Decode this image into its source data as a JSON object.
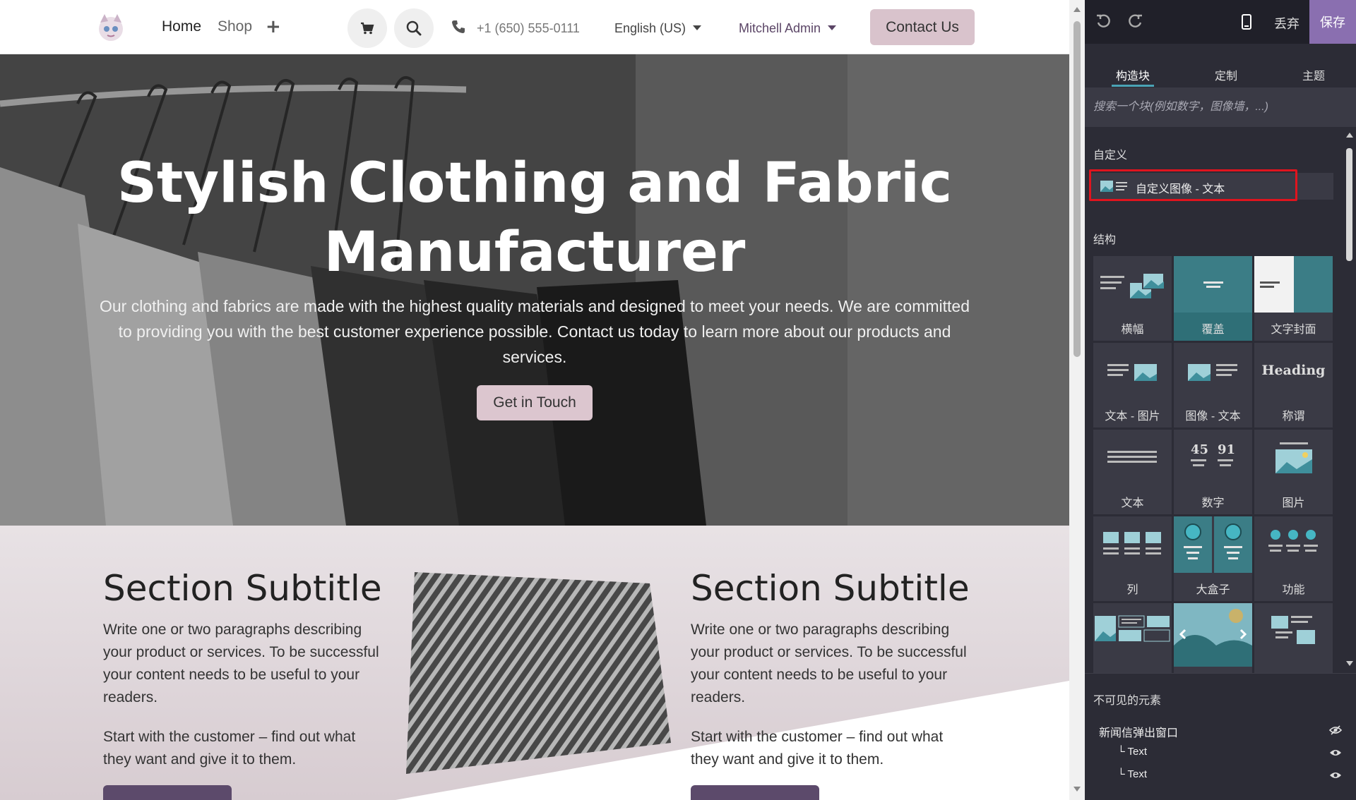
{
  "navbar": {
    "home": "Home",
    "shop": "Shop",
    "phone": "+1 (650) 555-0111",
    "language": "English (US)",
    "user": "Mitchell Admin",
    "contact": "Contact Us"
  },
  "hero": {
    "title": "Stylish Clothing and Fabric Manufacturer",
    "text": "Our clothing and fabrics are made with the highest quality materials and designed to meet your needs. We are committed to providing you with the best customer experience possible. Contact us today to learn more about our products and services.",
    "button": "Get in Touch"
  },
  "sections": [
    {
      "title": "Section Subtitle",
      "para1": "Write one or two paragraphs describing your product or services. To be successful your content needs to be useful to your readers.",
      "para2": "Start with the customer – find out what they want and give it to them."
    },
    {
      "title": "Section Subtitle",
      "para1": "Write one or two paragraphs describing your product or services. To be successful your content needs to be useful to your readers.",
      "para2": "Start with the customer – find out what they want and give it to them."
    }
  ],
  "editor": {
    "discard": "丢弃",
    "save": "保存",
    "tabs": [
      "构造块",
      "定制",
      "主题"
    ],
    "search_placeholder": "搜索一个块(例如数字，图像墙，...)",
    "custom_title": "自定义",
    "custom_item": "自定义图像 - 文本",
    "structure_title": "结构",
    "tiles": [
      "横幅",
      "覆盖",
      "文字封面",
      "文本 - 图片",
      "图像 - 文本",
      "称谓",
      "文本",
      "数字",
      "图片",
      "列",
      "大盒子",
      "功能"
    ],
    "heading_sample": "Heading",
    "numbers_sample": [
      "45",
      "91"
    ],
    "invisible_title": "不可见的元素",
    "invisible_items": [
      "新闻信弹出窗口",
      "└ Text",
      "└ Text"
    ]
  },
  "colors": {
    "accent_teal": "#4aa3b5",
    "save_purple": "#8a6fb0",
    "highlight_red": "#e0141e",
    "contact_pink": "#d9c3cc",
    "button_purple": "#5c4a6b"
  }
}
